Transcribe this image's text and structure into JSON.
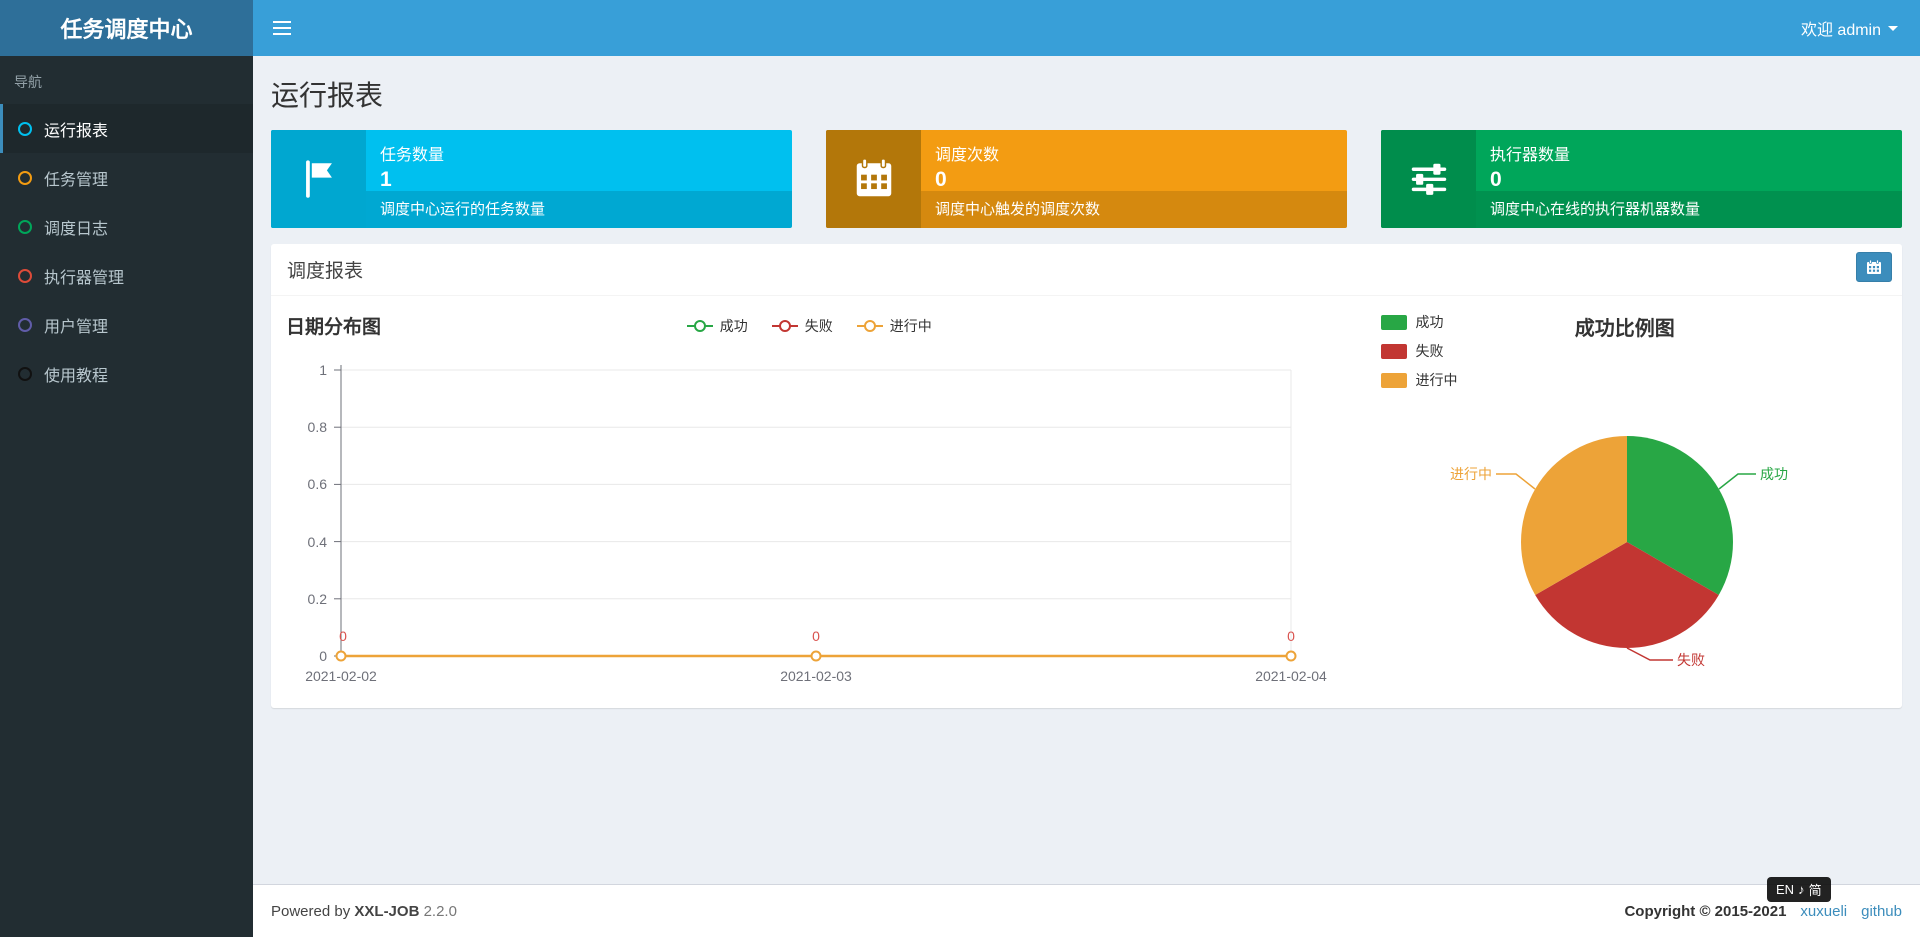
{
  "header": {
    "app_title": "任务调度中心",
    "menu_icon": "hamburger-icon",
    "welcome_text": "欢迎 admin"
  },
  "sidebar": {
    "nav_label": "导航",
    "items": [
      {
        "label": "运行报表",
        "icon": "circle-outline-icon",
        "icon_color": "#00c0ef",
        "active": true
      },
      {
        "label": "任务管理",
        "icon": "circle-outline-icon",
        "icon_color": "#f39c12",
        "active": false
      },
      {
        "label": "调度日志",
        "icon": "circle-outline-icon",
        "icon_color": "#00a65a",
        "active": false
      },
      {
        "label": "执行器管理",
        "icon": "circle-outline-icon",
        "icon_color": "#dd4b39",
        "active": false
      },
      {
        "label": "用户管理",
        "icon": "circle-outline-icon",
        "icon_color": "#605ca8",
        "active": false
      },
      {
        "label": "使用教程",
        "icon": "circle-outline-icon",
        "icon_color": "#111111",
        "active": false
      }
    ]
  },
  "page": {
    "title": "运行报表"
  },
  "stat_cards": [
    {
      "icon": "flag-icon",
      "label": "任务数量",
      "value": "1",
      "desc": "调度中心运行的任务数量",
      "color": "#00c0ef"
    },
    {
      "icon": "calendar-icon",
      "label": "调度次数",
      "value": "0",
      "desc": "调度中心触发的调度次数",
      "color": "#f39c12"
    },
    {
      "icon": "sliders-icon",
      "label": "执行器数量",
      "value": "0",
      "desc": "调度中心在线的执行器机器数量",
      "color": "#00a65a"
    }
  ],
  "report_panel": {
    "title": "调度报表",
    "date_button_icon": "calendar-icon"
  },
  "chart_data": [
    {
      "type": "line",
      "title": "日期分布图",
      "x": [
        "2021-02-02",
        "2021-02-03",
        "2021-02-04"
      ],
      "series": [
        {
          "name": "成功",
          "color": "#28a745",
          "values": [
            0,
            0,
            0
          ]
        },
        {
          "name": "失败",
          "color": "#c23632",
          "values": [
            0,
            0,
            0
          ]
        },
        {
          "name": "进行中",
          "color": "#eda338",
          "values": [
            0,
            0,
            0
          ]
        }
      ],
      "visible_point_labels": [
        "0",
        "0",
        "0"
      ],
      "ylim": [
        0,
        1
      ],
      "yticks": [
        "0",
        "0.2",
        "0.4",
        "0.6",
        "0.8",
        "1"
      ],
      "grid": true,
      "legend_position": "top-center"
    },
    {
      "type": "pie",
      "title": "成功比例图",
      "slices": [
        {
          "name": "成功",
          "color": "#28a745",
          "fraction": 0.333
        },
        {
          "name": "失败",
          "color": "#c23632",
          "fraction": 0.333
        },
        {
          "name": "进行中",
          "color": "#eda338",
          "fraction": 0.334
        }
      ],
      "legend_position": "top-left"
    }
  ],
  "footer": {
    "powered_prefix": "Powered by",
    "product": "XXL-JOB",
    "version": "2.2.0",
    "copyright": "Copyright © 2015-2021",
    "links": [
      {
        "label": "xuxueli"
      },
      {
        "label": "github"
      }
    ]
  },
  "ime_badge": {
    "text_left": "EN",
    "icon": "ime-mode-icon",
    "text_right": "简"
  }
}
